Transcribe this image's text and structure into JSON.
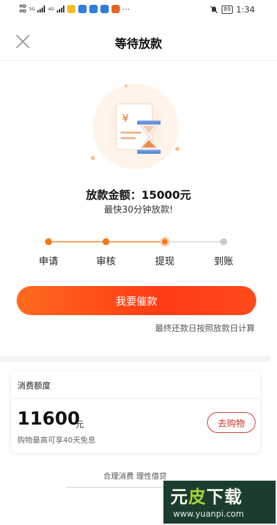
{
  "status_bar": {
    "time": "1:34",
    "battery": "89",
    "hd1": "HD",
    "hd2": "HD",
    "net1": "5G",
    "net2": "4G",
    "more": "···"
  },
  "nav": {
    "title": "等待放款"
  },
  "loan": {
    "amount_text": "放款金额：15000元",
    "subtitle": "最快30分钟放款!"
  },
  "steps": [
    {
      "label": "申请",
      "state": "done"
    },
    {
      "label": "审核",
      "state": "done"
    },
    {
      "label": "提现",
      "state": "current"
    },
    {
      "label": "到账",
      "state": "pending"
    }
  ],
  "actions": {
    "urge_label": "我要催款",
    "repay_note": "最终还款日按照放款日计算"
  },
  "credit": {
    "title": "消费额度",
    "amount": "11600",
    "unit": "元",
    "note": "购物最高可享40天免息",
    "shop_label": "去购物"
  },
  "footer": {
    "slogan": "合理消费 理性借贷"
  },
  "watermark": {
    "text_left": "元",
    "text_mid": "皮",
    "text_right": "下载",
    "url": "www.yuanpi.com"
  },
  "colors": {
    "accent_orange": "#f07b1c",
    "button_red": "#ff3b14",
    "shop_red": "#d0332c"
  }
}
